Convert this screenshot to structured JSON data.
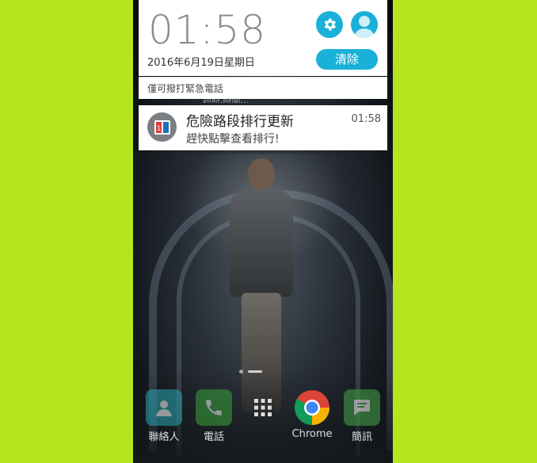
{
  "status": {
    "time": "01:58",
    "date": "2016年6月19日星期日",
    "clear_label": "清除",
    "emergency_text": "僅可撥打緊急電話",
    "lock_hint": "超時,時間…"
  },
  "notification": {
    "title": "危險路段排行更新",
    "time": "01:58",
    "text": "趕快點擊查看排行!",
    "icon": "app-notification-icon"
  },
  "dock": {
    "apps": [
      {
        "label": "聯絡人",
        "icon": "contacts-icon"
      },
      {
        "label": "電話",
        "icon": "phone-icon"
      },
      {
        "label": "",
        "icon": "app-drawer-icon"
      },
      {
        "label": "Chrome",
        "icon": "chrome-icon"
      },
      {
        "label": "簡訊",
        "icon": "messages-icon"
      }
    ]
  },
  "colors": {
    "accent": "#1ab0d8",
    "background": "#b5e61d"
  }
}
